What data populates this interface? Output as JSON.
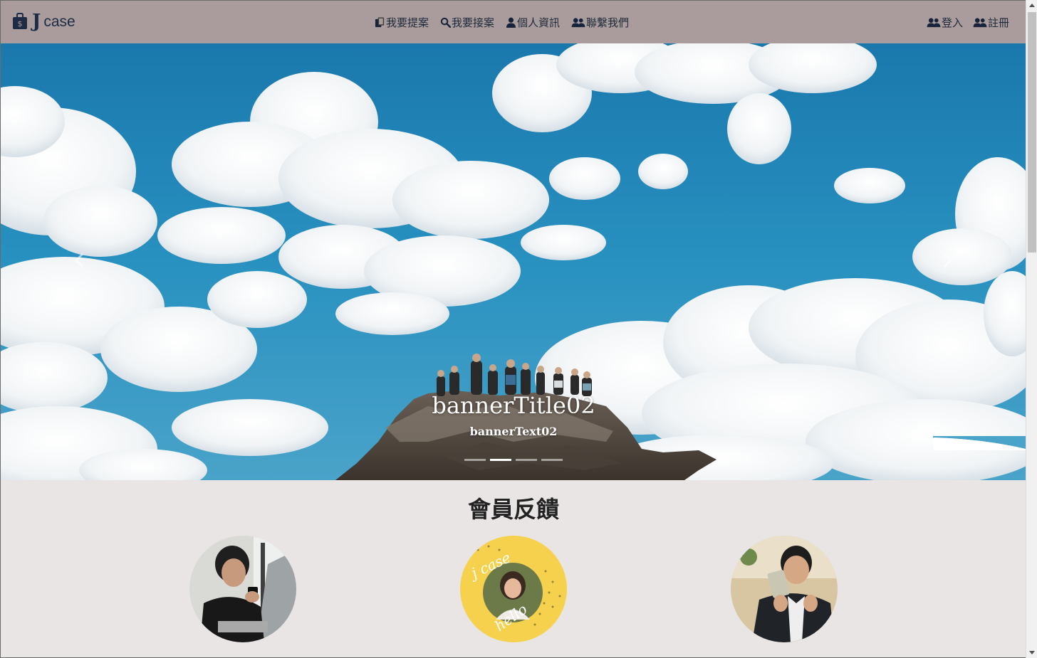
{
  "brand": {
    "logo_j": "J",
    "logo_case": "case",
    "icon": "money-bag-icon"
  },
  "nav": {
    "center": [
      {
        "label": "我要提案",
        "icon": "copy-icon"
      },
      {
        "label": "我要接案",
        "icon": "search-icon"
      },
      {
        "label": "個人資訊",
        "icon": "user-icon"
      },
      {
        "label": "聯繫我們",
        "icon": "users-icon"
      }
    ],
    "right": [
      {
        "label": "登入",
        "icon": "users-icon"
      },
      {
        "label": "註冊",
        "icon": "users-icon"
      }
    ]
  },
  "banner": {
    "title": "bannerTitle02",
    "text": "bannerText02",
    "slides_count": 4,
    "active_index": 1
  },
  "feedback": {
    "heading": "會員反饋",
    "avatars": [
      "member-avatar-1",
      "member-avatar-2",
      "member-avatar-3"
    ],
    "avatar2_lettering": "j case hello"
  },
  "colors": {
    "navbar_bg": "#aa9c9c",
    "page_bg": "#e8e5e4",
    "nav_text": "#1d2a3a",
    "sky": "#2691c0"
  }
}
